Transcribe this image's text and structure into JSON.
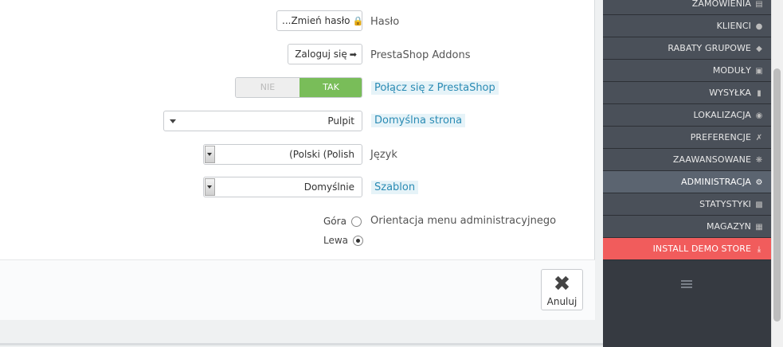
{
  "form": {
    "password": {
      "button_label": "...Zmień hasło",
      "label": "Hasło"
    },
    "addons": {
      "button_label": "Zaloguj się",
      "label": "PrestaShop Addons"
    },
    "connect": {
      "off_label": "NIE",
      "on_label": "TAK",
      "selected": "TAK",
      "label": "Połącz się z PrestaShop"
    },
    "default_page": {
      "value": "Pulpit",
      "label": "Domyślna strona"
    },
    "language": {
      "value": "(Polski (Polish",
      "label": "Język"
    },
    "theme": {
      "value": "Domyślnie",
      "label": "Szablon"
    },
    "menu_orientation": {
      "label": "Orientacja menu administracyjnego",
      "options": [
        {
          "label": "Góra",
          "checked": false
        },
        {
          "label": "Lewa",
          "checked": true
        }
      ]
    }
  },
  "footer": {
    "cancel_label": "Anuluj"
  },
  "sidebar": {
    "items": [
      {
        "label": "ZAMÓWIENIA",
        "icon": "orders-icon"
      },
      {
        "label": "KLIENCI",
        "icon": "users-icon"
      },
      {
        "label": "RABATY GRUPOWE",
        "icon": "tag-icon"
      },
      {
        "label": "MODUŁY",
        "icon": "puzzle-icon"
      },
      {
        "label": "WYSYŁKA",
        "icon": "truck-icon"
      },
      {
        "label": "LOKALIZACJA",
        "icon": "globe-icon"
      },
      {
        "label": "PREFERENCJE",
        "icon": "wrench-icon"
      },
      {
        "label": "ZAAWANSOWANE",
        "icon": "cogs-icon"
      },
      {
        "label": "ADMINISTRACJA",
        "icon": "gear-icon",
        "active": true
      },
      {
        "label": "STATYSTYKI",
        "icon": "bar-chart-icon"
      },
      {
        "label": "MAGAZYN",
        "icon": "archive-icon"
      },
      {
        "label": "INSTALL DEMO STORE",
        "icon": "download-icon"
      }
    ]
  },
  "colors": {
    "switch_on": "#79bd59",
    "demo_store": "#f15c5c",
    "sidebar_bg": "#363a41",
    "hint_text": "#2a8bb4"
  }
}
